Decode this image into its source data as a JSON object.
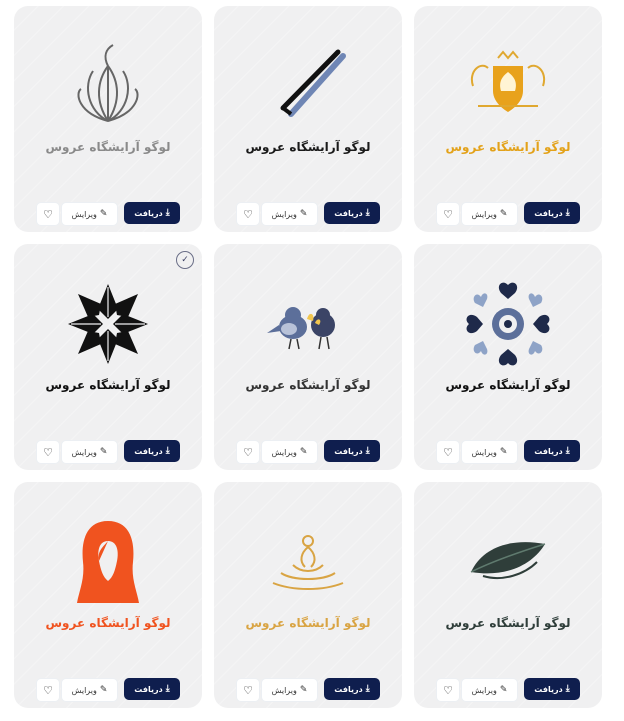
{
  "cards": [
    {
      "caption": "لوگو آرایشگاه عروس",
      "caption_color": "#8a8a8a",
      "logo": "lotus-line-logo",
      "download_label": "دریافت",
      "edit_label": "ویرایش"
    },
    {
      "caption": "لوگو آرایشگاه عروس",
      "caption_color": "#1a1a1a",
      "logo": "tweezers-logo",
      "download_label": "دریافت",
      "edit_label": "ویرایش"
    },
    {
      "caption": "لوگو آرایشگاه عروس",
      "caption_color": "#e3a21a",
      "logo": "gold-crest-logo",
      "download_label": "دریافت",
      "edit_label": "ویرایش"
    },
    {
      "caption": "لوگو آرایشگاه عروس",
      "caption_color": "#111111",
      "logo": "snowflake-logo",
      "download_label": "دریافت",
      "edit_label": "ویرایش",
      "verified": true
    },
    {
      "caption": "لوگو آرایشگاه عروس",
      "caption_color": "#333333",
      "logo": "two-birds-logo",
      "download_label": "دریافت",
      "edit_label": "ویرایش"
    },
    {
      "caption": "لوگو آرایشگاه عروس",
      "caption_color": "#111111",
      "logo": "heart-mandala-logo",
      "download_label": "دریافت",
      "edit_label": "ویرایش"
    },
    {
      "caption": "لوگو آرایشگاه عروس",
      "caption_color": "#f0531f",
      "logo": "orange-woman-logo",
      "download_label": "دریافت",
      "edit_label": "ویرایش"
    },
    {
      "caption": "لوگو آرایشگاه عروس",
      "caption_color": "#d9a443",
      "logo": "gold-meditation-logo",
      "download_label": "دریافت",
      "edit_label": "ویرایش"
    },
    {
      "caption": "لوگو آرایشگاه عروس",
      "caption_color": "#2f3e3a",
      "logo": "green-leaf-logo",
      "download_label": "دریافت",
      "edit_label": "ویرایش"
    }
  ],
  "colors": {
    "download_bg": "#0f1e4e",
    "card_bg": "#f0f0f1"
  },
  "icons": {
    "download": "download-icon",
    "edit": "pencil-icon",
    "like": "heart-icon",
    "verified": "badge-check-icon"
  }
}
